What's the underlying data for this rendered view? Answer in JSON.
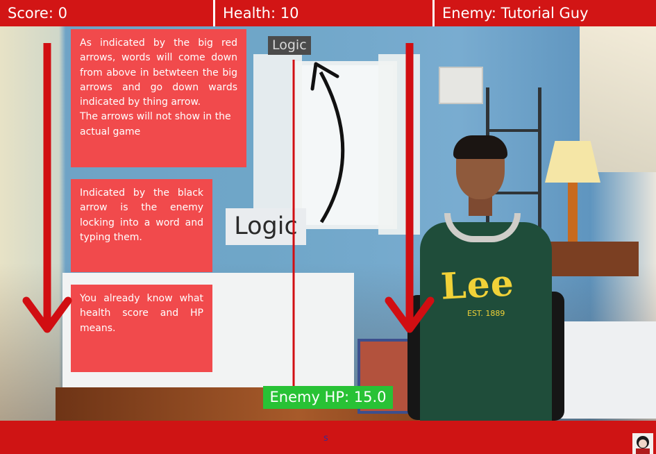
{
  "hud": {
    "score": "Score: 0",
    "health": "Health: 10",
    "enemy": "Enemy: Tutorial Guy"
  },
  "notes": {
    "arrows_line1": "As indicated by the big red arrows, words will come down from above in betwteen the big arrows and go down wards indicated by thing arrow.",
    "arrows_line2": "The arrows will not show in the actual game",
    "enemy_lock": "Indicated by the black arrow is the enemy locking into a word and typing them.",
    "stats": "You already know what health score and HP means."
  },
  "words": {
    "falling_word": "Logic",
    "typed_word": "Logic"
  },
  "enemy_hp": "Enemy HP: 15.0",
  "bottom": {
    "input_text": "s"
  },
  "shirt_logo": {
    "brand": "Lee",
    "est": "EST. 1889"
  },
  "colors": {
    "hud_red": "#d21515",
    "note_red": "#f14a4c",
    "hp_green": "#28c235",
    "arrow_red": "#d10e12",
    "arrow_black": "#111111"
  },
  "icons": {
    "big_arrows": "arrow-down-icon",
    "enemy_arrow": "curved-arrow-icon",
    "corner": "character-icon"
  }
}
